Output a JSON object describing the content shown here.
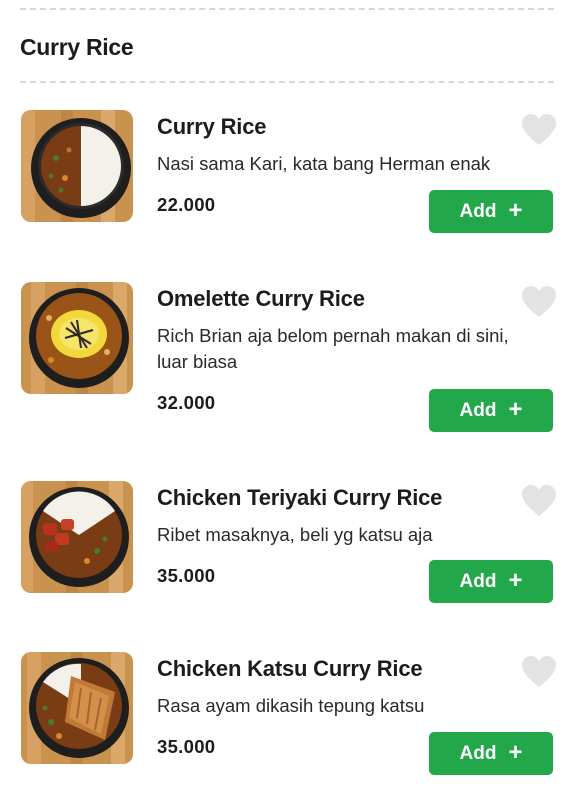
{
  "section": {
    "title": "Curry Rice"
  },
  "items": [
    {
      "name": "Curry Rice",
      "description": "Nasi sama Kari, kata bang Herman enak",
      "price": "22.000",
      "add_label": "Add",
      "favorite": false,
      "image_icon": "curry-rice-photo"
    },
    {
      "name": "Omelette Curry Rice",
      "description": "Rich Brian aja belom pernah makan di sini, luar biasa",
      "price": "32.000",
      "add_label": "Add",
      "favorite": false,
      "image_icon": "omelette-curry-rice-photo"
    },
    {
      "name": "Chicken Teriyaki Curry Rice",
      "description": "Ribet masaknya, beli yg katsu aja",
      "price": "35.000",
      "add_label": "Add",
      "favorite": false,
      "image_icon": "chicken-teriyaki-curry-rice-photo"
    },
    {
      "name": "Chicken Katsu Curry Rice",
      "description": "Rasa ayam dikasih tepung katsu",
      "price": "35.000",
      "add_label": "Add",
      "favorite": false,
      "image_icon": "chicken-katsu-curry-rice-photo"
    }
  ],
  "colors": {
    "accent": "#22a84a",
    "heart": "#e3e3e3",
    "divider": "#d8d8d8"
  }
}
